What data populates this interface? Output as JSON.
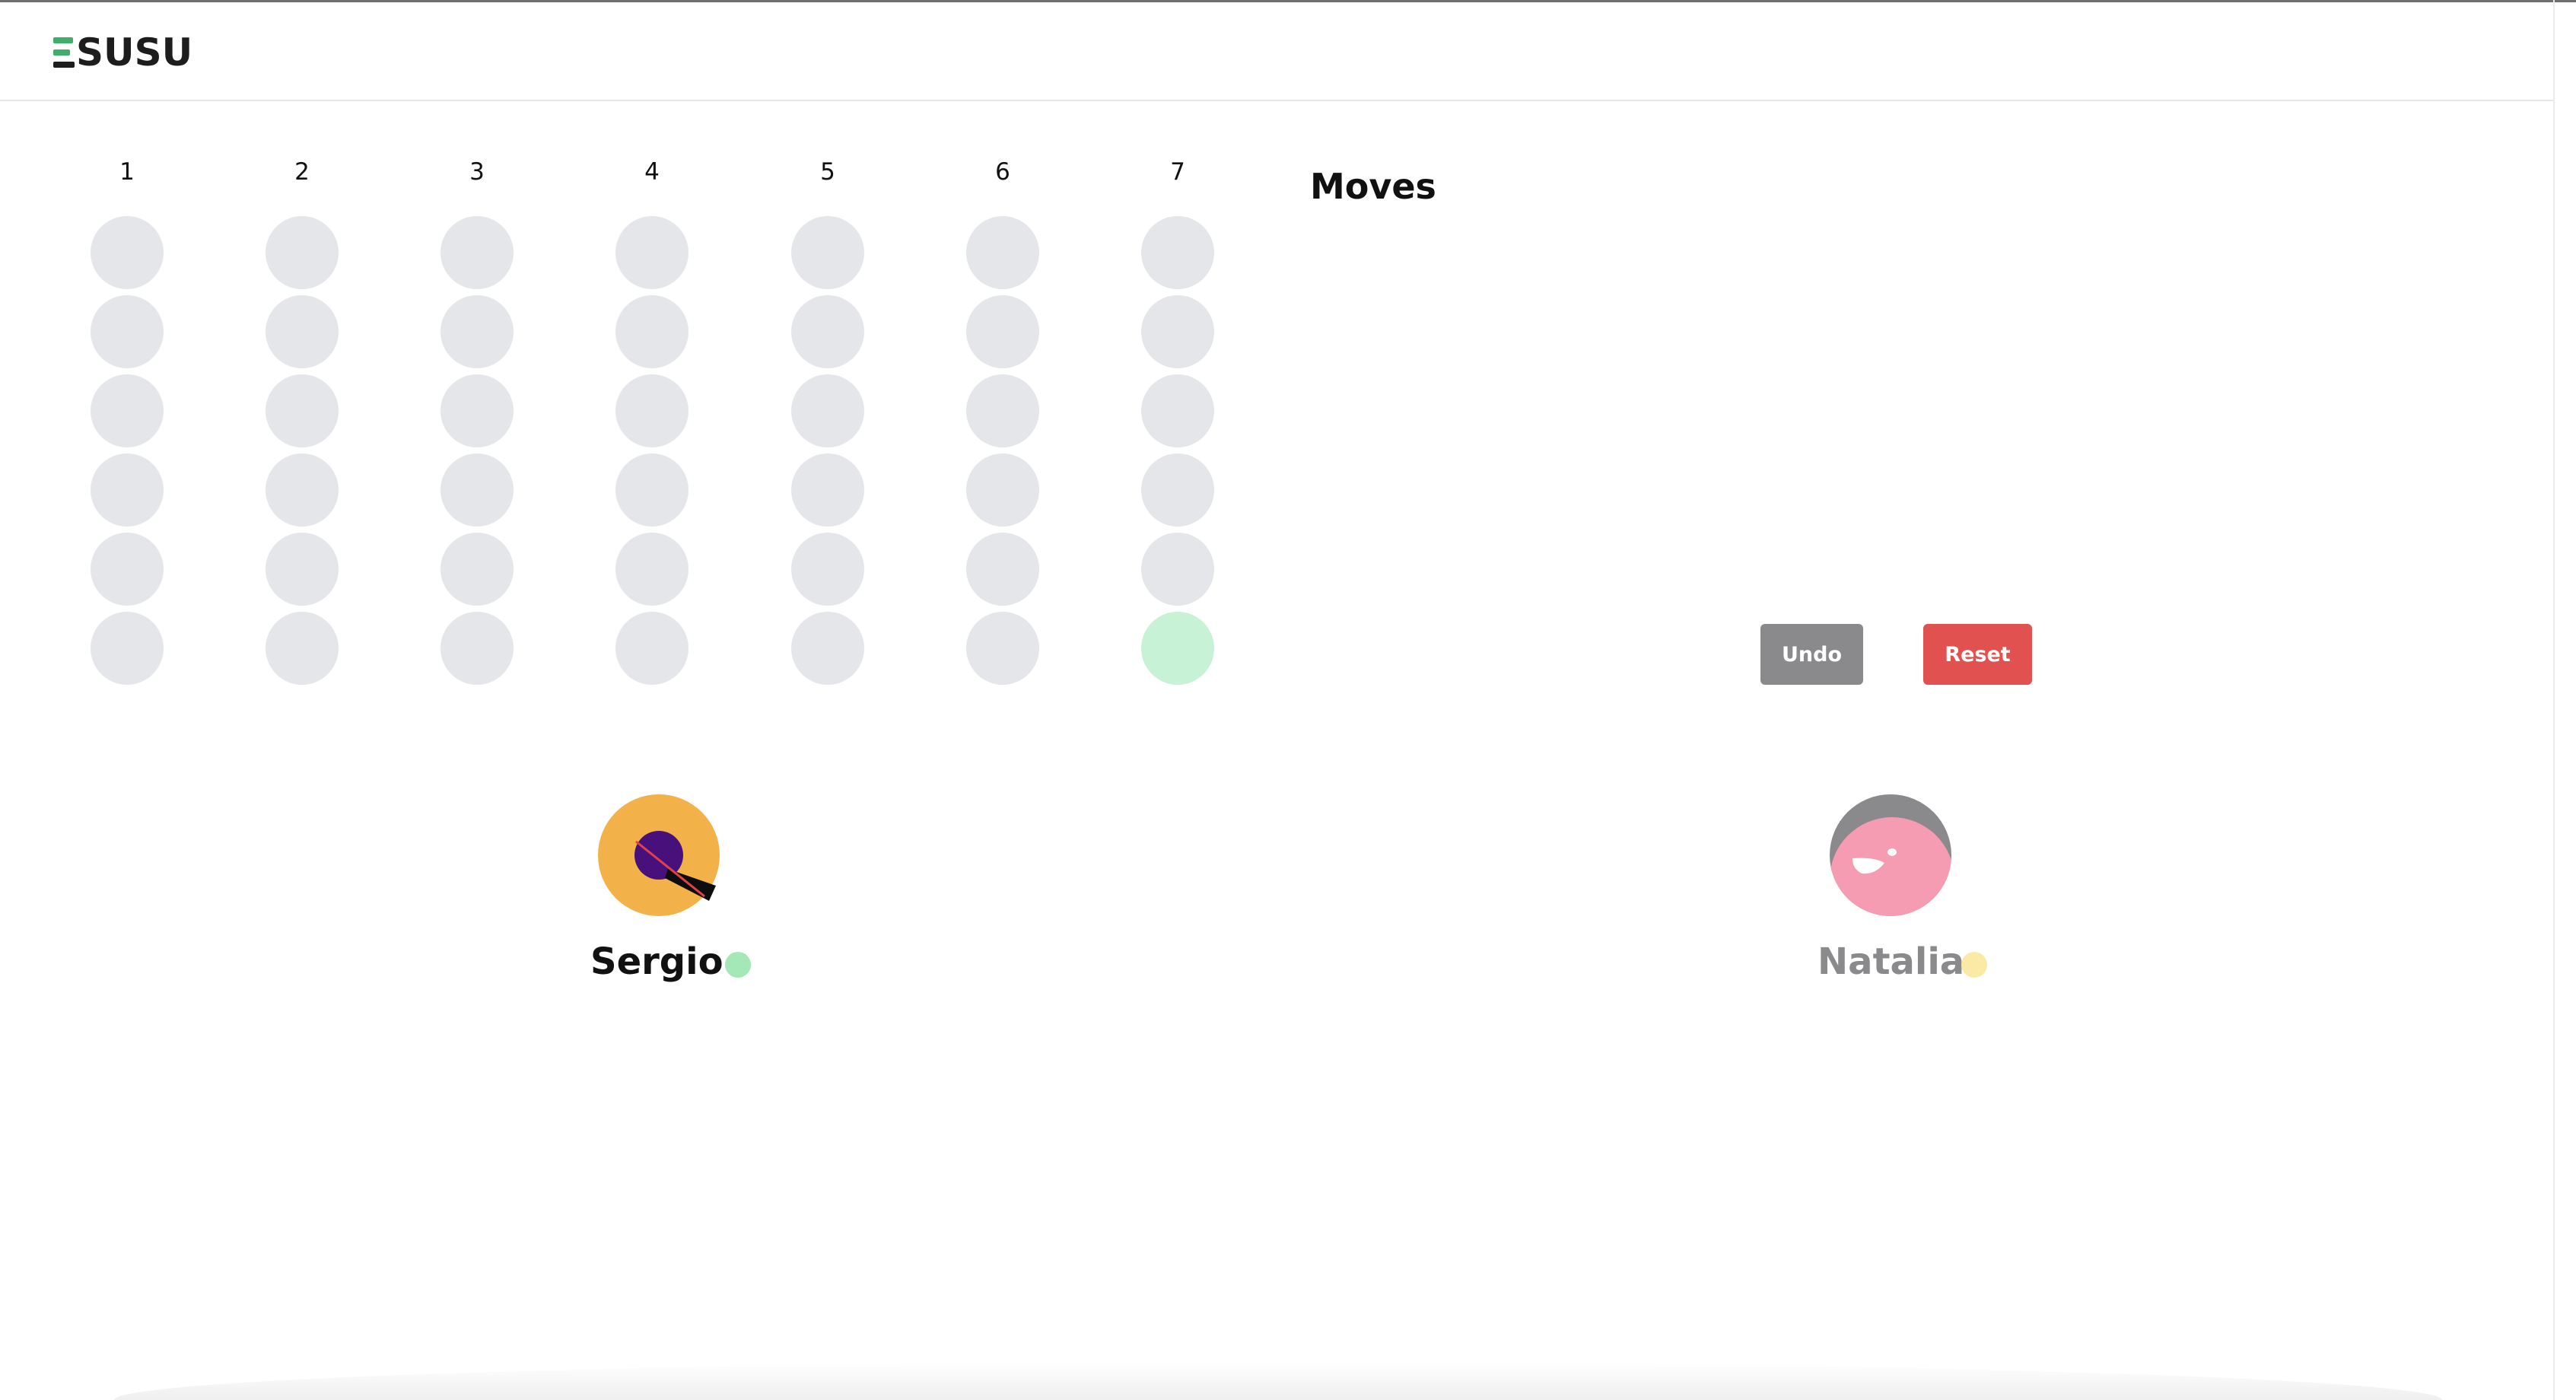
{
  "app": {
    "logo_text": "SUSU"
  },
  "board": {
    "column_labels": [
      "1",
      "2",
      "3",
      "4",
      "5",
      "6",
      "7"
    ],
    "rows": 6,
    "hover_cell": {
      "column": 7,
      "row": 6
    },
    "colors": {
      "empty_slot": "#e5e6e9",
      "hover_slot": "#c8f2d6"
    }
  },
  "moves": {
    "title": "Moves",
    "list": []
  },
  "controls": {
    "undo_label": "Undo",
    "reset_label": "Reset",
    "undo_color": "#8a8a8c",
    "reset_color": "#e0514f"
  },
  "players": [
    {
      "name": "Sergio",
      "active": true,
      "indicator_color": "#a3e8b6",
      "avatar_icon": "orange-avatar-icon"
    },
    {
      "name": "Natalia",
      "active": false,
      "indicator_color": "#fbeaa6",
      "avatar_icon": "pink-face-avatar-icon"
    }
  ]
}
